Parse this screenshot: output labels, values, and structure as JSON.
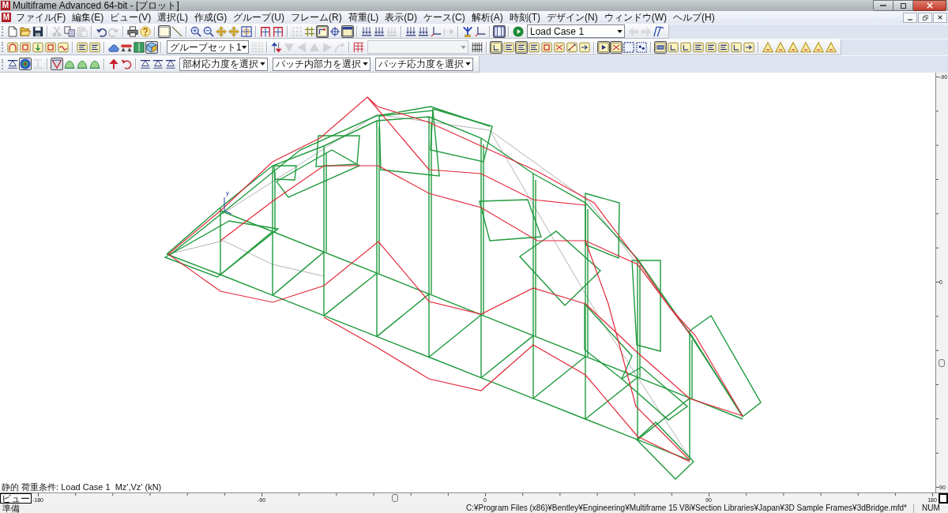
{
  "window": {
    "logo": "M",
    "title": "Multiframe Advanced 64-bit - [プロット]"
  },
  "menu_bar": {
    "logo": "M",
    "items": [
      "ファイル(F)",
      "編集(E)",
      "ビュー(V)",
      "選択(L)",
      "作成(G)",
      "グループ(U)",
      "フレーム(R)",
      "荷重(L)",
      "表示(D)",
      "ケース(C)",
      "解析(A)",
      "時刻(T)",
      "デザイン(N)",
      "ウィンドウ(W)",
      "ヘルプ(H)"
    ]
  },
  "toolbars": [
    {
      "items": [
        {
          "kind": "button",
          "pressed": false,
          "disabled": false
        },
        {
          "kind": "button",
          "pressed": false,
          "disabled": false
        },
        {
          "kind": "button",
          "pressed": false,
          "disabled": false
        },
        {
          "kind": "separator"
        },
        {
          "kind": "button",
          "pressed": false,
          "disabled": true
        },
        {
          "kind": "button",
          "pressed": false,
          "disabled": false
        },
        {
          "kind": "button",
          "pressed": false,
          "disabled": true
        },
        {
          "kind": "separator"
        },
        {
          "kind": "button",
          "pressed": false,
          "disabled": false
        },
        {
          "kind": "button",
          "pressed": false,
          "disabled": true
        },
        {
          "kind": "separator"
        },
        {
          "kind": "button",
          "pressed": false,
          "disabled": false
        },
        {
          "kind": "button",
          "pressed": false,
          "disabled": false
        },
        {
          "kind": "separator"
        },
        {
          "kind": "button",
          "pressed": true,
          "disabled": false
        },
        {
          "kind": "button",
          "pressed": false,
          "disabled": false
        },
        {
          "kind": "separator"
        },
        {
          "kind": "button",
          "pressed": false,
          "disabled": false
        },
        {
          "kind": "button",
          "pressed": false,
          "disabled": false
        },
        {
          "kind": "button",
          "pressed": false,
          "disabled": false
        },
        {
          "kind": "button",
          "pressed": false,
          "disabled": false
        },
        {
          "kind": "button",
          "pressed": false,
          "disabled": false
        },
        {
          "kind": "separator"
        },
        {
          "kind": "button",
          "pressed": false,
          "disabled": false
        },
        {
          "kind": "button",
          "pressed": false,
          "disabled": false
        },
        {
          "kind": "separator"
        },
        {
          "kind": "button",
          "pressed": false,
          "disabled": true
        },
        {
          "kind": "button",
          "pressed": false,
          "disabled": false
        },
        {
          "kind": "button",
          "pressed": true,
          "disabled": false
        },
        {
          "kind": "button",
          "pressed": false,
          "disabled": false
        },
        {
          "kind": "button",
          "pressed": true,
          "disabled": false
        },
        {
          "kind": "separator"
        },
        {
          "kind": "button",
          "pressed": false,
          "disabled": false
        },
        {
          "kind": "button",
          "pressed": false,
          "disabled": false
        },
        {
          "kind": "button",
          "pressed": false,
          "disabled": true
        },
        {
          "kind": "separator"
        },
        {
          "kind": "button",
          "pressed": false,
          "disabled": false
        },
        {
          "kind": "button",
          "pressed": false,
          "disabled": false
        },
        {
          "kind": "button",
          "pressed": false,
          "disabled": false
        },
        {
          "kind": "button",
          "pressed": false,
          "disabled": true
        },
        {
          "kind": "separator"
        },
        {
          "kind": "button",
          "pressed": false,
          "disabled": false
        },
        {
          "kind": "button",
          "pressed": false,
          "disabled": false
        },
        {
          "kind": "separator"
        },
        {
          "kind": "button",
          "pressed": true,
          "disabled": false
        },
        {
          "kind": "separator"
        },
        {
          "kind": "button",
          "pressed": false,
          "disabled": false
        },
        {
          "kind": "dropdown",
          "value": "Load Case 1",
          "disabled": false
        },
        {
          "kind": "button",
          "pressed": false,
          "disabled": true
        },
        {
          "kind": "button",
          "pressed": false,
          "disabled": true
        },
        {
          "kind": "button",
          "pressed": false,
          "disabled": false
        }
      ]
    },
    {
      "items": [
        {
          "kind": "button",
          "pressed": false,
          "disabled": false
        },
        {
          "kind": "button",
          "pressed": false,
          "disabled": false
        },
        {
          "kind": "button",
          "pressed": false,
          "disabled": false
        },
        {
          "kind": "button",
          "pressed": false,
          "disabled": false
        },
        {
          "kind": "button",
          "pressed": false,
          "disabled": false
        },
        {
          "kind": "separator"
        },
        {
          "kind": "button",
          "pressed": false,
          "disabled": false
        },
        {
          "kind": "button",
          "pressed": false,
          "disabled": false
        },
        {
          "kind": "separator"
        },
        {
          "kind": "button",
          "pressed": false,
          "disabled": false
        },
        {
          "kind": "button",
          "pressed": false,
          "disabled": false
        },
        {
          "kind": "button",
          "pressed": false,
          "disabled": false
        },
        {
          "kind": "button",
          "pressed": true,
          "disabled": false
        },
        {
          "kind": "separator"
        },
        {
          "kind": "dropdown",
          "value": "グループセット1",
          "disabled": false
        },
        {
          "kind": "button",
          "pressed": false,
          "disabled": true
        },
        {
          "kind": "separator"
        },
        {
          "kind": "button",
          "pressed": false,
          "disabled": false
        },
        {
          "kind": "button",
          "pressed": false,
          "disabled": true
        },
        {
          "kind": "button",
          "pressed": false,
          "disabled": true
        },
        {
          "kind": "button",
          "pressed": false,
          "disabled": true
        },
        {
          "kind": "button",
          "pressed": false,
          "disabled": true
        },
        {
          "kind": "button",
          "pressed": false,
          "disabled": true
        },
        {
          "kind": "separator"
        },
        {
          "kind": "button",
          "pressed": false,
          "disabled": false
        },
        {
          "kind": "dropdown",
          "disabled": true
        },
        {
          "kind": "button",
          "pressed": false,
          "disabled": false
        },
        {
          "kind": "separator"
        },
        {
          "kind": "button",
          "pressed": true,
          "disabled": false
        },
        {
          "kind": "button",
          "pressed": false,
          "disabled": false
        },
        {
          "kind": "button",
          "pressed": true,
          "disabled": false
        },
        {
          "kind": "button",
          "pressed": false,
          "disabled": false
        },
        {
          "kind": "button",
          "pressed": false,
          "disabled": false
        },
        {
          "kind": "button",
          "pressed": false,
          "disabled": false
        },
        {
          "kind": "button",
          "pressed": false,
          "disabled": false
        },
        {
          "kind": "button",
          "pressed": false,
          "disabled": false
        },
        {
          "kind": "separator"
        },
        {
          "kind": "button",
          "pressed": true,
          "disabled": false
        },
        {
          "kind": "button",
          "pressed": true,
          "disabled": false
        },
        {
          "kind": "button",
          "pressed": false,
          "disabled": false
        },
        {
          "kind": "button",
          "pressed": false,
          "disabled": false
        },
        {
          "kind": "separator"
        },
        {
          "kind": "button",
          "pressed": true,
          "disabled": false
        },
        {
          "kind": "button",
          "pressed": false,
          "disabled": false
        },
        {
          "kind": "button",
          "pressed": false,
          "disabled": false
        },
        {
          "kind": "button",
          "pressed": false,
          "disabled": false
        },
        {
          "kind": "button",
          "pressed": false,
          "disabled": false
        },
        {
          "kind": "button",
          "pressed": false,
          "disabled": false
        },
        {
          "kind": "button",
          "pressed": false,
          "disabled": false
        },
        {
          "kind": "button",
          "pressed": false,
          "disabled": false
        },
        {
          "kind": "separator"
        },
        {
          "kind": "button",
          "pressed": false,
          "disabled": false
        },
        {
          "kind": "button",
          "pressed": false,
          "disabled": false
        },
        {
          "kind": "button",
          "pressed": false,
          "disabled": false
        },
        {
          "kind": "button",
          "pressed": false,
          "disabled": false
        },
        {
          "kind": "button",
          "pressed": false,
          "disabled": false
        },
        {
          "kind": "button",
          "pressed": false,
          "disabled": false
        }
      ]
    },
    {
      "items": [
        {
          "kind": "button",
          "pressed": false,
          "disabled": false
        },
        {
          "kind": "button",
          "pressed": true,
          "disabled": false
        },
        {
          "kind": "button",
          "pressed": false,
          "disabled": true
        },
        {
          "kind": "separator"
        },
        {
          "kind": "button",
          "pressed": true,
          "disabled": false
        },
        {
          "kind": "button",
          "pressed": false,
          "disabled": false
        },
        {
          "kind": "button",
          "pressed": false,
          "disabled": false
        },
        {
          "kind": "button",
          "pressed": false,
          "disabled": false
        },
        {
          "kind": "separator"
        },
        {
          "kind": "button",
          "pressed": false,
          "disabled": false
        },
        {
          "kind": "button",
          "pressed": false,
          "disabled": false
        },
        {
          "kind": "separator"
        },
        {
          "kind": "button",
          "pressed": false,
          "disabled": false
        },
        {
          "kind": "button",
          "pressed": false,
          "disabled": false
        },
        {
          "kind": "button",
          "pressed": false,
          "disabled": false
        },
        {
          "kind": "dropdown",
          "value": "部材応力度を選択",
          "disabled": false
        },
        {
          "kind": "dropdown",
          "value": "パッチ内部力を選択",
          "disabled": false
        },
        {
          "kind": "dropdown",
          "value": "パッチ応力度を選択",
          "disabled": false
        }
      ]
    }
  ],
  "plot": {
    "axis_label": "y",
    "caption": "静的 荷重条件: Load Case 1  Mz',Vz' (kN)"
  },
  "vertical_ruler": {
    "labels": [
      "-90",
      "0",
      "90"
    ]
  },
  "horizontal_ruler": {
    "view_tab": "ビュー",
    "labels": [
      "-180",
      "-90",
      "0",
      "90",
      "180"
    ]
  },
  "status_bar": {
    "message": "準備",
    "path": "C:¥Program Files (x86)¥Bentley¥Engineering¥Multiframe 15 V8i¥Section Libraries¥Japan¥3D Sample Frames¥3dBridge.mfd*",
    "indicator": "NUM"
  }
}
